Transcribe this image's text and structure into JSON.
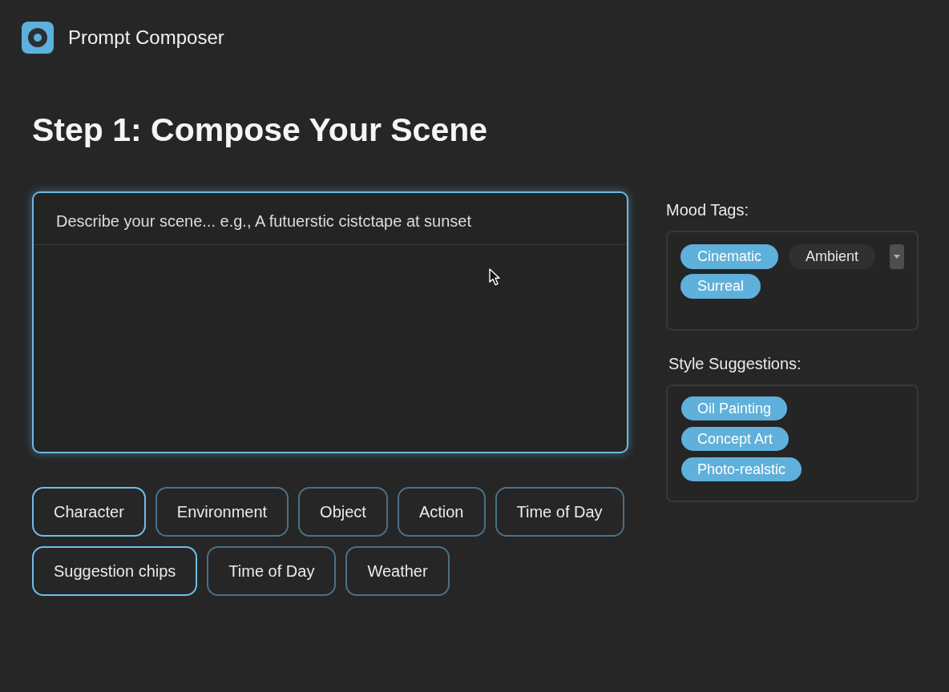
{
  "app": {
    "title": "Prompt Composer"
  },
  "heading": "Step 1: Compose Your Scene",
  "composer": {
    "placeholder": "Describe your scene... e.g., A futuerstic cistctape at sunset"
  },
  "element_chips": [
    {
      "label": "Character",
      "selected": true
    },
    {
      "label": "Environment",
      "selected": false
    },
    {
      "label": "Object",
      "selected": false
    },
    {
      "label": "Action",
      "selected": false
    },
    {
      "label": "Time of Day",
      "selected": false
    },
    {
      "label": "Suggestion chips",
      "selected": true
    },
    {
      "label": "Time of Day",
      "selected": false
    },
    {
      "label": "Weather",
      "selected": false
    }
  ],
  "mood_tags": {
    "label": "Mood Tags:",
    "tags": [
      {
        "label": "Cinematic",
        "selected": true
      },
      {
        "label": "Ambient",
        "selected": false
      },
      {
        "label": "Surreal",
        "selected": true
      }
    ]
  },
  "style_suggestions": {
    "label": "Style Suggestions:",
    "items": [
      {
        "label": "Oil Painting",
        "selected": true
      },
      {
        "label": "Concept Art",
        "selected": true
      },
      {
        "label": "Photo-realstic",
        "selected": true
      }
    ]
  }
}
